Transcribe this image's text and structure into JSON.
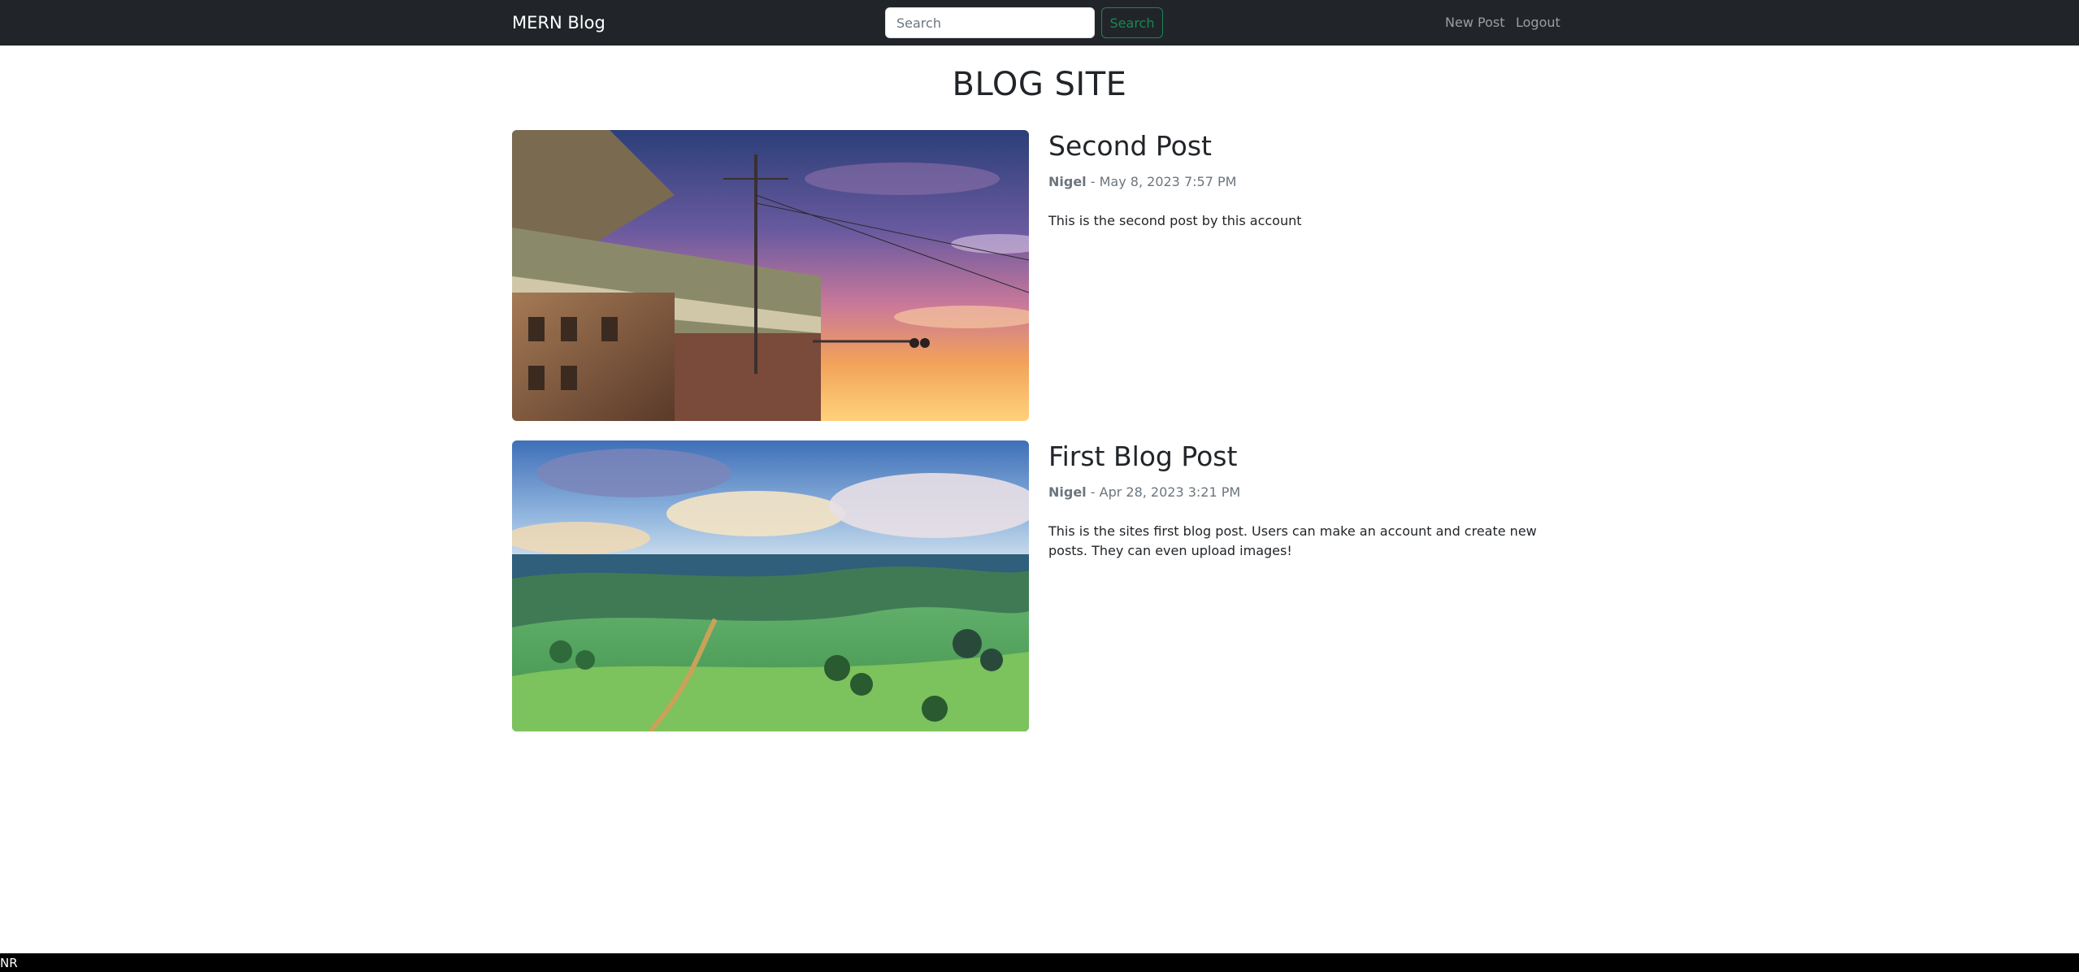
{
  "navbar": {
    "brand": "MERN Blog",
    "search_placeholder": "Search",
    "search_button": "Search",
    "links": [
      "New Post",
      "Logout"
    ]
  },
  "page": {
    "title": "BLOG SITE"
  },
  "posts": [
    {
      "title": "Second Post",
      "author": "Nigel",
      "date": "May 8, 2023 7:57 PM",
      "summary": "This is the second post by this account"
    },
    {
      "title": "First Blog Post",
      "author": "Nigel",
      "date": "Apr 28, 2023 3:21 PM",
      "summary": "This is the sites first blog post. Users can make an account and create new posts. They can even upload images!"
    }
  ],
  "bottom_bar": {
    "text": "NR"
  },
  "colors": {
    "navbar_bg": "#212529",
    "search_accent": "#198754",
    "muted": "#6c757d"
  }
}
